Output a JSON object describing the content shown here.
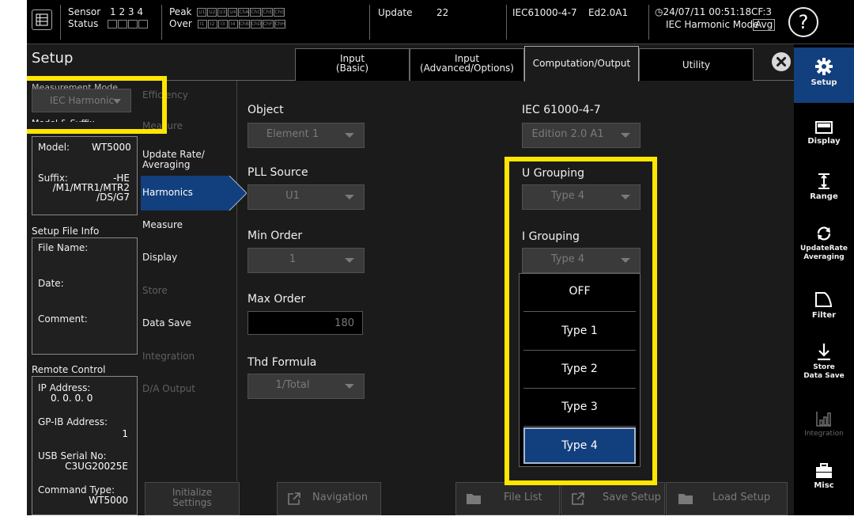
{
  "status": {
    "sensor_label": "Sensor",
    "sensor_channels": [
      "1",
      "2",
      "3",
      "4"
    ],
    "status_label": "Status",
    "peak_label": "Peak",
    "over_label": "Over",
    "peak_channels": [
      "U1",
      "U2",
      "U3",
      "U4",
      "ChA",
      "ChC",
      "ChE",
      "ChG"
    ],
    "over_channels": [
      "I1",
      "I2",
      "I3",
      "I4",
      "ChB",
      "ChD",
      "ChF",
      "ChH"
    ],
    "update_label": "Update",
    "update_value": "22",
    "standard": "IEC61000-4-7",
    "edition": "Ed2.0A1",
    "datetime": "24/07/11 00:51:18",
    "cf": "CF:3",
    "mode": "IEC Harmonic Mode",
    "avg": "Avg",
    "help_symbol": "?"
  },
  "setup": {
    "title": "Setup",
    "measurement_mode_label": "Measurement Mode",
    "measurement_mode_value": "IEC Harmonic",
    "model_suffix_label": "Model & Suffix",
    "model_label": "Model:",
    "model_value": "WT5000",
    "suffix_label": "Suffix:",
    "suffix_line1": "-HE",
    "suffix_line2": "/M1/MTR1/MTR2",
    "suffix_line3": "/DS/G7",
    "setup_file_info_label": "Setup File Info",
    "file_name_label": "File Name:",
    "date_label": "Date:",
    "comment_label": "Comment:",
    "remote_control_label": "Remote Control",
    "ip_label": "IP Address:",
    "ip_value": "0.  0.  0.  0",
    "gpib_label": "GP-IB Address:",
    "gpib_value": "1",
    "usb_label": "USB Serial No:",
    "usb_value": "C3UG20025E",
    "command_label": "Command Type:",
    "command_value": "WT5000"
  },
  "tabs": [
    {
      "line1": "Input",
      "line2": "(Basic)"
    },
    {
      "line1": "Input",
      "line2": "(Advanced/Options)"
    },
    {
      "line1": "Computation/Output",
      "line2": ""
    },
    {
      "line1": "Utility",
      "line2": ""
    }
  ],
  "menu": [
    {
      "label": "Efficiency",
      "enabled": false
    },
    {
      "label": "Measure",
      "enabled": false
    },
    {
      "label": "Update Rate/",
      "label2": "Averaging",
      "enabled": true
    },
    {
      "label": "Harmonics",
      "enabled": true
    },
    {
      "label": "Measure",
      "enabled": true
    },
    {
      "label": "Display",
      "enabled": true
    },
    {
      "label": "Store",
      "enabled": false
    },
    {
      "label": "Data Save",
      "enabled": true
    },
    {
      "label": "Integration",
      "enabled": false
    },
    {
      "label": "D/A Output",
      "enabled": false
    }
  ],
  "fields": {
    "object_label": "Object",
    "object_value": "Element 1",
    "pll_label": "PLL Source",
    "pll_value": "U1",
    "min_order_label": "Min Order",
    "min_order_value": "1",
    "max_order_label": "Max Order",
    "max_order_value": "180",
    "thd_label": "Thd Formula",
    "thd_value": "1/Total",
    "iec_label": "IEC 61000-4-7",
    "iec_value": "Edition 2.0 A1",
    "u_grouping_label": "U Grouping",
    "u_grouping_value": "Type 4",
    "i_grouping_label": "I Grouping",
    "i_grouping_value": "Type 4"
  },
  "grouping_options": [
    "OFF",
    "Type 1",
    "Type 2",
    "Type 3",
    "Type 4"
  ],
  "grouping_selected": "Type 4",
  "bottom": {
    "initialize_line1": "Initialize",
    "initialize_line2": "Settings",
    "navigation": "Navigation",
    "file_list": "File List",
    "save_setup": "Save Setup",
    "load_setup": "Load Setup"
  },
  "sidebar": [
    {
      "label": "Setup",
      "label2": "",
      "icon": "gear-icon"
    },
    {
      "label": "Display",
      "label2": "",
      "icon": "display-icon"
    },
    {
      "label": "Range",
      "label2": "",
      "icon": "range-icon"
    },
    {
      "label": "UpdateRate",
      "label2": "Averaging",
      "icon": "refresh-icon"
    },
    {
      "label": "Filter",
      "label2": "",
      "icon": "filter-icon"
    },
    {
      "label": "Store",
      "label2": "Data Save",
      "icon": "download-icon"
    },
    {
      "label": "Integration",
      "label2": "",
      "icon": "integration-icon"
    },
    {
      "label": "Misc",
      "label2": "",
      "icon": "toolbox-icon"
    }
  ],
  "colors": {
    "accent": "#123f7d",
    "highlight": "#ffe600",
    "background": "#1b1b1b"
  }
}
